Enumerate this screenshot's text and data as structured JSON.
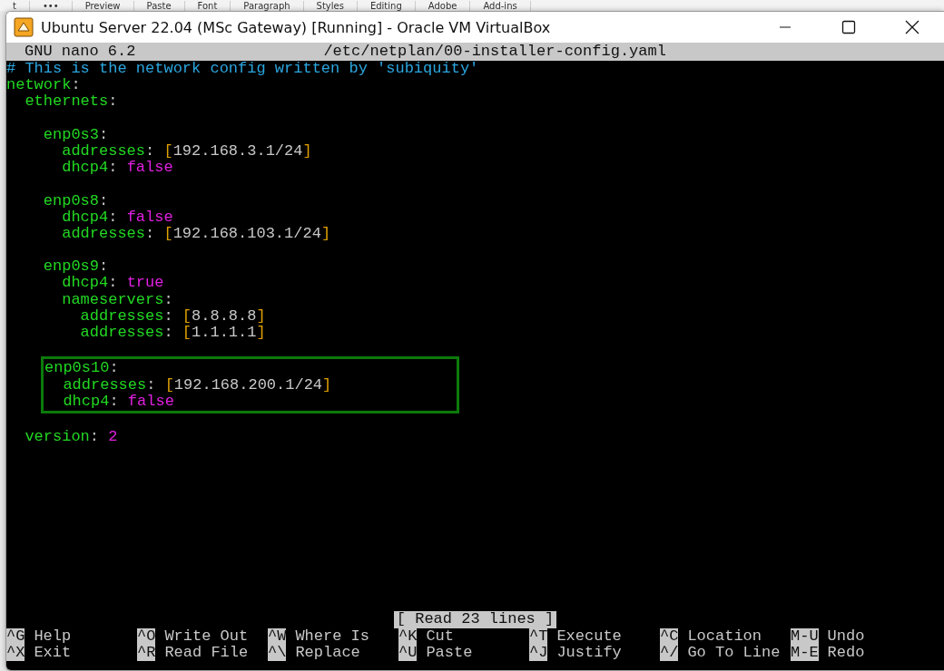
{
  "background_ribbon": [
    "t",
    "•••",
    "Preview",
    "Paste",
    "Font",
    "Paragraph",
    "Styles",
    "Editing",
    "Adobe",
    "Add-ins"
  ],
  "window": {
    "title": "Ubuntu Server 22.04 (MSc Gateway) [Running] - Oracle VM VirtualBox"
  },
  "nano": {
    "version": "GNU nano 6.2",
    "file": "/etc/netplan/00-installer-config.yaml",
    "lines": [
      {
        "kind": "code",
        "tokens": [
          {
            "text": "# This is the network config written by 'subiquity'",
            "kind": "comment"
          }
        ]
      },
      {
        "kind": "code",
        "tokens": [
          {
            "text": "network",
            "kind": "key"
          },
          {
            "text": ":",
            "kind": "punct"
          }
        ]
      },
      {
        "kind": "code",
        "tokens": [
          {
            "text": "  ethernets",
            "kind": "key"
          },
          {
            "text": ":",
            "kind": "punct"
          }
        ]
      },
      {
        "kind": "blank"
      },
      {
        "kind": "code",
        "tokens": [
          {
            "text": "    enp0s3",
            "kind": "key"
          },
          {
            "text": ":",
            "kind": "punct"
          }
        ]
      },
      {
        "kind": "code",
        "tokens": [
          {
            "text": "      addresses",
            "kind": "key"
          },
          {
            "text": ": ",
            "kind": "punct"
          },
          {
            "text": "[",
            "kind": "bracket"
          },
          {
            "text": "192.168.3.1/24",
            "kind": "plain"
          },
          {
            "text": "]",
            "kind": "bracket"
          }
        ]
      },
      {
        "kind": "code",
        "tokens": [
          {
            "text": "      dhcp4",
            "kind": "key"
          },
          {
            "text": ": ",
            "kind": "punct"
          },
          {
            "text": "false",
            "kind": "literal"
          }
        ]
      },
      {
        "kind": "blank"
      },
      {
        "kind": "code",
        "tokens": [
          {
            "text": "    enp0s8",
            "kind": "key"
          },
          {
            "text": ":",
            "kind": "punct"
          }
        ]
      },
      {
        "kind": "code",
        "tokens": [
          {
            "text": "      dhcp4",
            "kind": "key"
          },
          {
            "text": ": ",
            "kind": "punct"
          },
          {
            "text": "false",
            "kind": "literal"
          }
        ]
      },
      {
        "kind": "code",
        "tokens": [
          {
            "text": "      addresses",
            "kind": "key"
          },
          {
            "text": ": ",
            "kind": "punct"
          },
          {
            "text": "[",
            "kind": "bracket"
          },
          {
            "text": "192.168.103.1/24",
            "kind": "plain"
          },
          {
            "text": "]",
            "kind": "bracket"
          }
        ]
      },
      {
        "kind": "blank"
      },
      {
        "kind": "code",
        "tokens": [
          {
            "text": "    enp0s9",
            "kind": "key"
          },
          {
            "text": ":",
            "kind": "punct"
          }
        ]
      },
      {
        "kind": "code",
        "tokens": [
          {
            "text": "      dhcp4",
            "kind": "key"
          },
          {
            "text": ": ",
            "kind": "punct"
          },
          {
            "text": "true",
            "kind": "literal"
          }
        ]
      },
      {
        "kind": "code",
        "tokens": [
          {
            "text": "      nameservers",
            "kind": "key"
          },
          {
            "text": ":",
            "kind": "punct"
          }
        ]
      },
      {
        "kind": "code",
        "tokens": [
          {
            "text": "        addresses",
            "kind": "key"
          },
          {
            "text": ": ",
            "kind": "punct"
          },
          {
            "text": "[",
            "kind": "bracket"
          },
          {
            "text": "8.8.8.8",
            "kind": "plain"
          },
          {
            "text": "]",
            "kind": "bracket"
          }
        ]
      },
      {
        "kind": "code",
        "tokens": [
          {
            "text": "        addresses",
            "kind": "key"
          },
          {
            "text": ": ",
            "kind": "punct"
          },
          {
            "text": "[",
            "kind": "bracket"
          },
          {
            "text": "1.1.1.1",
            "kind": "plain"
          },
          {
            "text": "]",
            "kind": "bracket"
          }
        ]
      },
      {
        "kind": "blank"
      },
      {
        "kind": "boxed",
        "lines": [
          {
            "kind": "code",
            "tokens": [
              {
                "text": "enp0s10",
                "kind": "key"
              },
              {
                "text": ":",
                "kind": "punct"
              }
            ]
          },
          {
            "kind": "code",
            "tokens": [
              {
                "text": "  addresses",
                "kind": "key"
              },
              {
                "text": ": ",
                "kind": "punct"
              },
              {
                "text": "[",
                "kind": "bracket"
              },
              {
                "text": "192.168.200.1/24",
                "kind": "plain"
              },
              {
                "text": "]",
                "kind": "bracket"
              }
            ]
          },
          {
            "kind": "code",
            "tokens": [
              {
                "text": "  dhcp4",
                "kind": "key"
              },
              {
                "text": ": ",
                "kind": "punct"
              },
              {
                "text": "false",
                "kind": "literal"
              }
            ]
          }
        ]
      },
      {
        "kind": "blank"
      },
      {
        "kind": "code",
        "tokens": [
          {
            "text": "  version",
            "kind": "key"
          },
          {
            "text": ": ",
            "kind": "punct"
          },
          {
            "text": "2",
            "kind": "literal"
          }
        ]
      }
    ],
    "status": "[ Read 23 lines ]",
    "shortcuts": [
      [
        {
          "key": "^G",
          "label": "Help"
        },
        {
          "key": "^O",
          "label": "Write Out"
        },
        {
          "key": "^W",
          "label": "Where Is"
        },
        {
          "key": "^K",
          "label": "Cut"
        },
        {
          "key": "^T",
          "label": "Execute"
        },
        {
          "key": "^C",
          "label": "Location"
        },
        {
          "key": "M-U",
          "label": "Undo"
        }
      ],
      [
        {
          "key": "^X",
          "label": "Exit"
        },
        {
          "key": "^R",
          "label": "Read File"
        },
        {
          "key": "^\\",
          "label": "Replace"
        },
        {
          "key": "^U",
          "label": "Paste"
        },
        {
          "key": "^J",
          "label": "Justify"
        },
        {
          "key": "^/",
          "label": "Go To Line"
        },
        {
          "key": "M-E",
          "label": "Redo"
        }
      ]
    ]
  }
}
